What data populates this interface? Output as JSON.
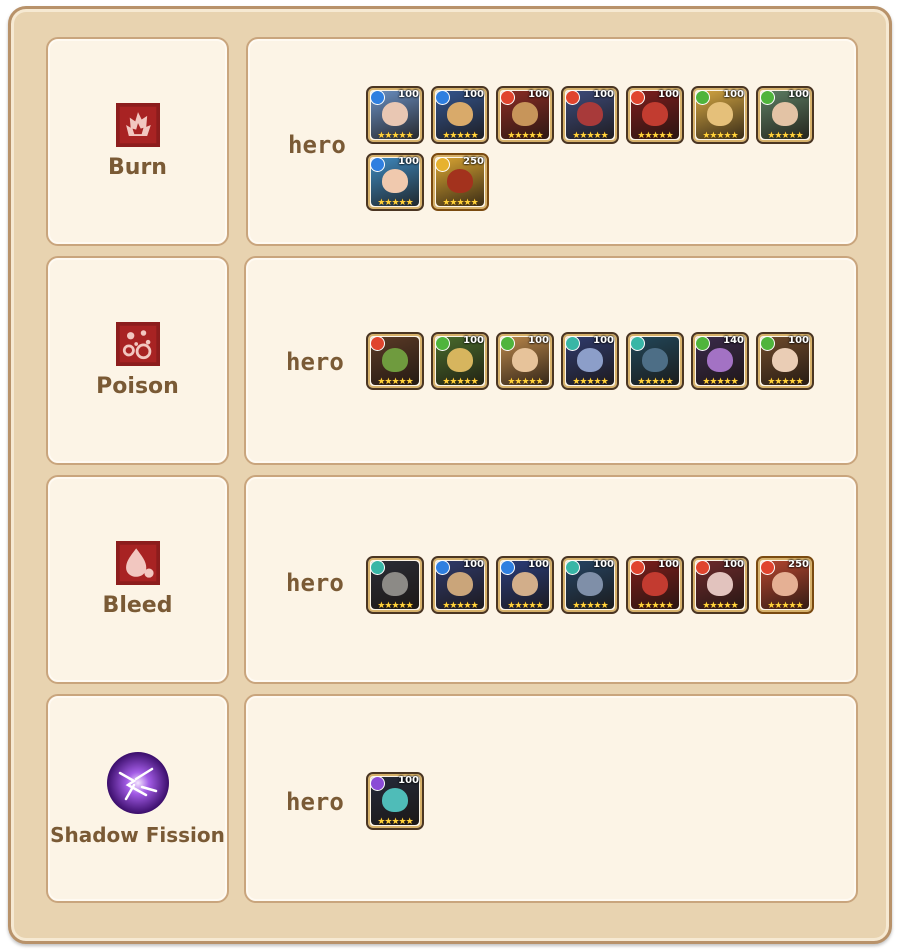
{
  "rows": [
    {
      "status": "Burn",
      "icon": "burn-icon",
      "title": "hero",
      "heroes": [
        {
          "element": "water",
          "level": "100",
          "bg": "#6a8fc2",
          "face": "#e9c7b3"
        },
        {
          "element": "water",
          "level": "100",
          "bg": "#34558e",
          "face": "#d9aa6a"
        },
        {
          "element": "fire",
          "level": "100",
          "bg": "#8b2d25",
          "face": "#c7955a"
        },
        {
          "element": "fire",
          "level": "100",
          "bg": "#3d4b7b",
          "face": "#a83a3a"
        },
        {
          "element": "fire",
          "level": "100",
          "bg": "#7d1d1d",
          "face": "#c23c30"
        },
        {
          "element": "nature",
          "level": "100",
          "bg": "#d4a642",
          "face": "#e5c07a"
        },
        {
          "element": "nature",
          "level": "100",
          "bg": "#5d7e63",
          "face": "#e3c3a5"
        },
        {
          "element": "water",
          "level": "100",
          "bg": "#3e89bf",
          "face": "#f0c9ae"
        },
        {
          "element": "light",
          "level": "250",
          "bg": "#d9a432",
          "face": "#a3321d"
        }
      ]
    },
    {
      "status": "Poison",
      "icon": "poison-icon",
      "title": "hero",
      "heroes": [
        {
          "element": "fire",
          "level": "",
          "bg": "#5b3a26",
          "face": "#6f9b3e"
        },
        {
          "element": "nature",
          "level": "100",
          "bg": "#496b2c",
          "face": "#d7b55e"
        },
        {
          "element": "nature",
          "level": "100",
          "bg": "#b9864a",
          "face": "#e7c39a"
        },
        {
          "element": "dark",
          "level": "100",
          "bg": "#2f3b6d",
          "face": "#8c9ec9"
        },
        {
          "element": "dark",
          "level": "",
          "bg": "#21475a",
          "face": "#4d6e86"
        },
        {
          "element": "nature",
          "level": "140",
          "bg": "#3a2a4b",
          "face": "#a372c4"
        },
        {
          "element": "nature",
          "level": "100",
          "bg": "#6f4a2b",
          "face": "#eacdb5"
        }
      ]
    },
    {
      "status": "Bleed",
      "icon": "bleed-icon",
      "title": "hero",
      "heroes": [
        {
          "element": "dark",
          "level": "",
          "bg": "#2b2d36",
          "face": "#8c8a86"
        },
        {
          "element": "water",
          "level": "100",
          "bg": "#2f3a6b",
          "face": "#caa57a"
        },
        {
          "element": "water",
          "level": "100",
          "bg": "#2a3d7a",
          "face": "#d2ae8a"
        },
        {
          "element": "dark",
          "level": "100",
          "bg": "#254463",
          "face": "#7f8fa8"
        },
        {
          "element": "fire",
          "level": "100",
          "bg": "#7c1e1b",
          "face": "#c33b30"
        },
        {
          "element": "fire",
          "level": "100",
          "bg": "#6e2a2c",
          "face": "#e2c3be"
        },
        {
          "element": "fire",
          "level": "250",
          "bg": "#b4462f",
          "face": "#e5b094"
        }
      ]
    },
    {
      "status": "Shadow Fission",
      "icon": "shadow-fission-icon",
      "title": "hero",
      "heroes": [
        {
          "element": "void",
          "level": "100",
          "bg": "#252a3a",
          "face": "#4fbcb8"
        }
      ]
    }
  ],
  "stars": "★★★★★",
  "element_colors": {
    "water": "#2f7fe0",
    "fire": "#e0442e",
    "nature": "#4fb43c",
    "dark": "#38b6a6",
    "light": "#e7b22f",
    "void": "#8a4bd6"
  }
}
